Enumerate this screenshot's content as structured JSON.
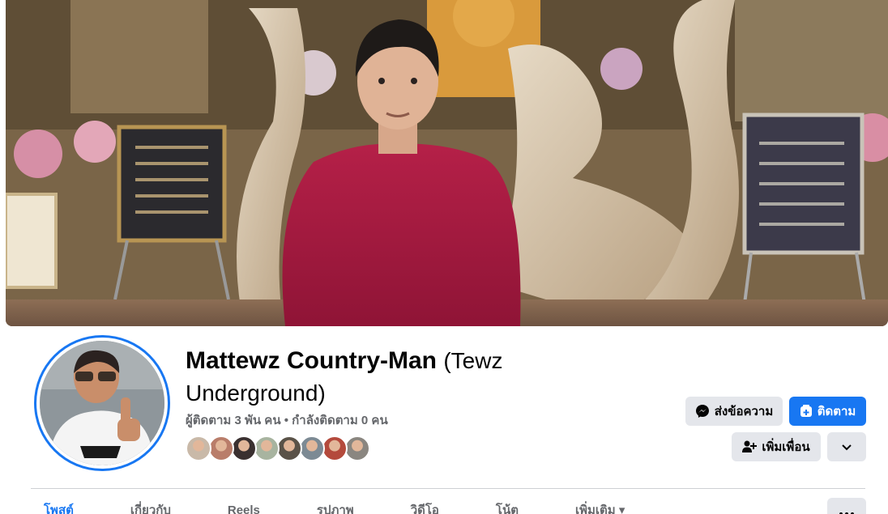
{
  "profile": {
    "name": "Mattewz Country-Man",
    "alternate_name": "(Tewz Underground)",
    "followers_text": "ผู้ติดตาม 3 พัน คน • กำลังติดตาม 0 คน"
  },
  "actions": {
    "message_label": "ส่งข้อความ",
    "follow_label": "ติดตาม",
    "add_friend_label": "เพิ่มเพื่อน"
  },
  "tabs": [
    {
      "label": "โพสต์",
      "active": true
    },
    {
      "label": "เกี่ยวกับ",
      "active": false
    },
    {
      "label": "Reels",
      "active": false
    },
    {
      "label": "รูปภาพ",
      "active": false
    },
    {
      "label": "วิดีโอ",
      "active": false
    },
    {
      "label": "โน้ต",
      "active": false
    },
    {
      "label": "เพิ่มเติม",
      "active": false
    }
  ],
  "friend_avatars": [
    "#c9b9a8",
    "#b97d6a",
    "#3a3030",
    "#a8b4a0",
    "#5a5248",
    "#7c8a94",
    "#b44a3c",
    "#8a8680"
  ],
  "colors": {
    "accent": "#1877f2",
    "text_primary": "#050505",
    "text_secondary": "#65676b",
    "button_gray": "#e4e6eb"
  },
  "icons": {
    "message": "messenger-icon",
    "follow": "follow-icon",
    "add_friend": "add-friend-icon",
    "dropdown": "chevron-down-icon",
    "more": "ellipsis-icon"
  }
}
